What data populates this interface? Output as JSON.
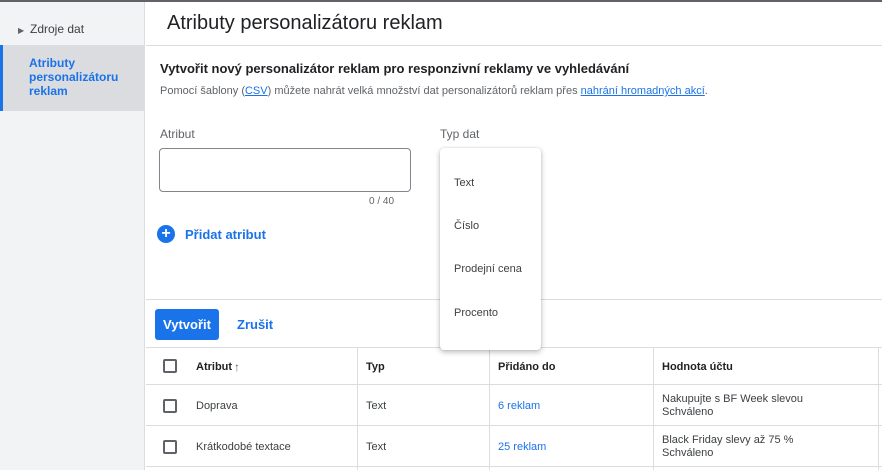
{
  "sidebar": {
    "items": [
      {
        "label": "Zdroje dat"
      },
      {
        "label": "Atributy personalizátoru reklam"
      }
    ]
  },
  "header": {
    "title": "Atributy personalizátoru reklam"
  },
  "form": {
    "title": "Vytvořit nový personalizátor reklam pro responzivní reklamy ve vyhledávání",
    "subtitle_pre": "Pomocí šablony (",
    "csv_link": "CSV",
    "subtitle_mid": ") můžete nahrát velká množství dat personalizátorů reklam přes ",
    "bulk_link": "nahrání hromadných akcí",
    "subtitle_post": ".",
    "attribute_label": "Atribut",
    "attribute_value": "",
    "counter": "0 / 40",
    "type_label": "Typ dat",
    "add_attribute": "Přidat atribut"
  },
  "dropdown": {
    "options": [
      "Text",
      "Číslo",
      "Prodejní cena",
      "Procento"
    ]
  },
  "actions": {
    "create": "Vytvořit",
    "cancel": "Zrušit"
  },
  "table": {
    "headers": [
      "Atribut",
      "Typ",
      "Přidáno do",
      "Hodnota účtu"
    ],
    "rows": [
      {
        "attribute": "Doprava",
        "type": "Text",
        "added_to": "6 reklam",
        "account_value": "Nakupujte s BF Week slevou",
        "status": "Schváleno"
      },
      {
        "attribute": "Krátkodobé textace",
        "type": "Text",
        "added_to": "25 reklam",
        "account_value": "Black Friday slevy až 75 %",
        "status": "Schváleno"
      }
    ]
  },
  "colors": {
    "accent": "#1a73e8",
    "sidebar_bg": "#f1f3f4"
  },
  "icons": {
    "expand": "triangle-right-icon",
    "add": "plus-circle-icon",
    "sort": "arrow-up-icon"
  }
}
